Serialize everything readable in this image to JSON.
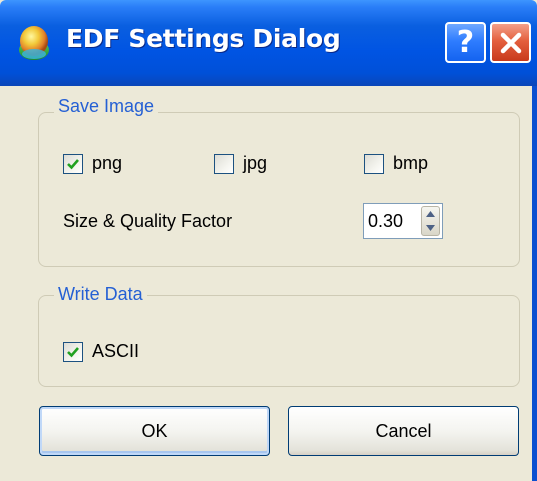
{
  "window": {
    "title": "EDF Settings Dialog",
    "help_glyph": "?",
    "close_glyph": "✕"
  },
  "icons": {
    "app": "app-logo-icon",
    "help": "help-icon",
    "close": "close-icon",
    "check": "checkmark-icon",
    "spin_up": "arrow-up-icon",
    "spin_down": "arrow-down-icon"
  },
  "save_image": {
    "title": "Save Image",
    "formats": [
      {
        "label": "png",
        "checked": true
      },
      {
        "label": "jpg",
        "checked": false
      },
      {
        "label": "bmp",
        "checked": false
      }
    ],
    "quality_label": "Size & Quality Factor",
    "quality_value": "0.30"
  },
  "write_data": {
    "title": "Write Data",
    "ascii_label": "ASCII",
    "ascii_checked": true
  },
  "buttons": {
    "ok": "OK",
    "cancel": "Cancel"
  },
  "colors": {
    "titlebar": "#0054e3",
    "group_title": "#2560d4",
    "dialog_bg": "#ece9d8",
    "check": "#21a121"
  }
}
